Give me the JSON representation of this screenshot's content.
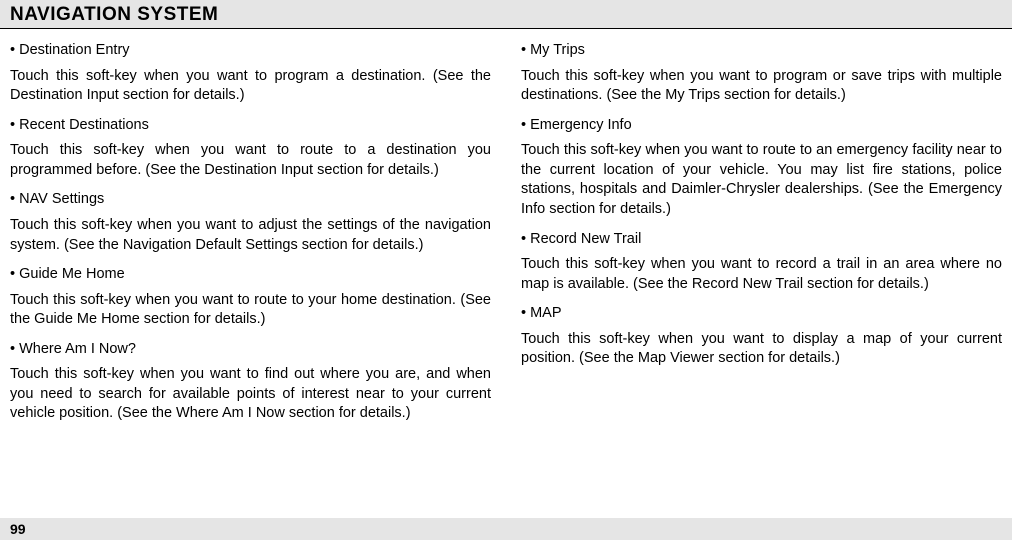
{
  "header": {
    "title": "NAVIGATION SYSTEM"
  },
  "left_column": {
    "items": [
      {
        "title": "• Destination Entry",
        "body": "Touch this soft-key when you want to program a destination. (See the  Destination Input section for details.)"
      },
      {
        "title": "• Recent Destinations",
        "body": "Touch this soft-key when you want to route to a destination you programmed before.  (See the  Destination Input section for details.)"
      },
      {
        "title": "• NAV Settings",
        "body": "Touch this soft-key when you want to adjust the settings of the navigation system. (See the  Navigation Default Settings section for details.)"
      },
      {
        "title": "• Guide Me Home",
        "body": "Touch this soft-key when you want to route to your home destination.  (See the  Guide Me Home section for details.)"
      },
      {
        "title": "• Where Am I Now?",
        "body": "Touch this soft-key when you want to find out where you are, and when you need to search for available points of interest near to your current vehicle position. (See the  Where Am I Now section for details.)"
      }
    ]
  },
  "right_column": {
    "items": [
      {
        "title": "• My Trips",
        "body": "Touch this soft-key when you want to program or save trips with multiple destinations.  (See the  My Trips section for details.)"
      },
      {
        "title": "• Emergency Info",
        "body": "Touch this soft-key when you want to route to an emergency facility near to the current location of your vehicle.  You may list fire stations, police stations, hospitals and Daimler-Chrysler dealerships. (See the  Emergency Info section for details.)"
      },
      {
        "title": "• Record New Trail",
        "body": "Touch this soft-key when you want to record a trail in an area where no map is available. (See the  Record New Trail section for details.)"
      },
      {
        "title": "• MAP",
        "body": "Touch this soft-key when you want to display a map of your current position. (See the  Map Viewer section for details.)"
      }
    ]
  },
  "footer": {
    "page_number": "99"
  }
}
